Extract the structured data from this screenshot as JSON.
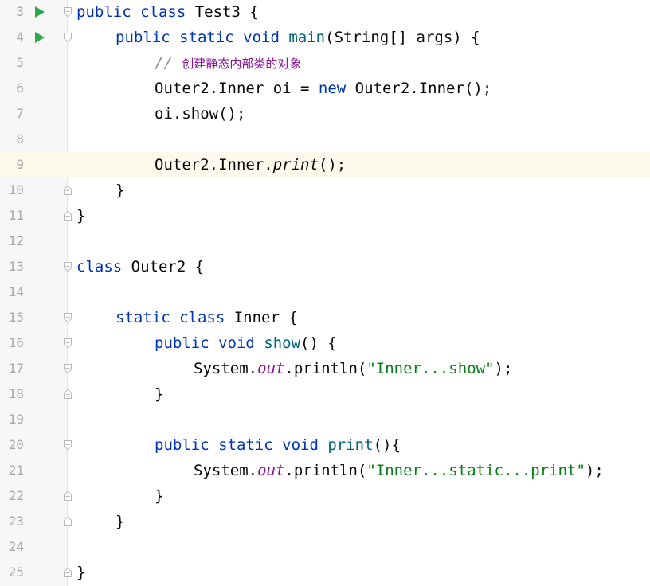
{
  "editor": {
    "current_line": 9,
    "lines": [
      {
        "n": "3",
        "indent": 0,
        "run": true,
        "fold": "open",
        "tokens": [
          {
            "t": "public ",
            "c": "kw"
          },
          {
            "t": "class ",
            "c": "kw"
          },
          {
            "t": "Test3 {",
            "c": ""
          }
        ]
      },
      {
        "n": "4",
        "indent": 1,
        "run": true,
        "fold": "open",
        "tokens": [
          {
            "t": "public ",
            "c": "kw"
          },
          {
            "t": "static ",
            "c": "kw"
          },
          {
            "t": "void ",
            "c": "kw"
          },
          {
            "t": "main",
            "c": "fn"
          },
          {
            "t": "(String[] args) {",
            "c": ""
          }
        ]
      },
      {
        "n": "5",
        "indent": 2,
        "tokens": [
          {
            "t": "// ",
            "c": "cmt"
          },
          {
            "t": "创建静态内部类的对象",
            "c": "cmt-cn"
          }
        ]
      },
      {
        "n": "6",
        "indent": 2,
        "tokens": [
          {
            "t": "Outer2.Inner oi = ",
            "c": ""
          },
          {
            "t": "new ",
            "c": "kw"
          },
          {
            "t": "Outer2.Inner();",
            "c": ""
          }
        ]
      },
      {
        "n": "7",
        "indent": 2,
        "tokens": [
          {
            "t": "oi.show();",
            "c": ""
          }
        ]
      },
      {
        "n": "8",
        "indent": 0,
        "tokens": []
      },
      {
        "n": "9",
        "indent": 2,
        "tokens": [
          {
            "t": "Outer2.Inner.",
            "c": ""
          },
          {
            "t": "print",
            "c": "ital"
          },
          {
            "t": "();",
            "c": ""
          }
        ]
      },
      {
        "n": "10",
        "indent": 1,
        "fold": "close",
        "tokens": [
          {
            "t": "}",
            "c": ""
          }
        ]
      },
      {
        "n": "11",
        "indent": 0,
        "fold": "close",
        "tokens": [
          {
            "t": "}",
            "c": ""
          }
        ]
      },
      {
        "n": "12",
        "indent": 0,
        "tokens": []
      },
      {
        "n": "13",
        "indent": 0,
        "fold": "open",
        "tokens": [
          {
            "t": "class ",
            "c": "kw"
          },
          {
            "t": "Outer2 {",
            "c": ""
          }
        ]
      },
      {
        "n": "14",
        "indent": 0,
        "tokens": []
      },
      {
        "n": "15",
        "indent": 1,
        "fold": "open",
        "tokens": [
          {
            "t": "static ",
            "c": "kw"
          },
          {
            "t": "class ",
            "c": "kw"
          },
          {
            "t": "Inner {",
            "c": ""
          }
        ]
      },
      {
        "n": "16",
        "indent": 2,
        "fold": "open",
        "tokens": [
          {
            "t": "public ",
            "c": "kw"
          },
          {
            "t": "void ",
            "c": "kw"
          },
          {
            "t": "show",
            "c": "fn"
          },
          {
            "t": "() {",
            "c": ""
          }
        ]
      },
      {
        "n": "17",
        "indent": 3,
        "fold": "open",
        "tokens": [
          {
            "t": "System.",
            "c": ""
          },
          {
            "t": "out",
            "c": "fld"
          },
          {
            "t": ".println(",
            "c": ""
          },
          {
            "t": "\"Inner...show\"",
            "c": "str"
          },
          {
            "t": ");",
            "c": ""
          }
        ]
      },
      {
        "n": "18",
        "indent": 2,
        "fold": "close",
        "tokens": [
          {
            "t": "}",
            "c": ""
          }
        ]
      },
      {
        "n": "19",
        "indent": 0,
        "tokens": []
      },
      {
        "n": "20",
        "indent": 2,
        "fold": "open",
        "tokens": [
          {
            "t": "public ",
            "c": "kw"
          },
          {
            "t": "static ",
            "c": "kw"
          },
          {
            "t": "void ",
            "c": "kw"
          },
          {
            "t": "print",
            "c": "fn"
          },
          {
            "t": "(){",
            "c": ""
          }
        ]
      },
      {
        "n": "21",
        "indent": 3,
        "tokens": [
          {
            "t": "System.",
            "c": ""
          },
          {
            "t": "out",
            "c": "fld"
          },
          {
            "t": ".println(",
            "c": ""
          },
          {
            "t": "\"Inner...static...print\"",
            "c": "str"
          },
          {
            "t": ");",
            "c": ""
          }
        ]
      },
      {
        "n": "22",
        "indent": 2,
        "fold": "close",
        "tokens": [
          {
            "t": "}",
            "c": ""
          }
        ]
      },
      {
        "n": "23",
        "indent": 1,
        "fold": "close",
        "tokens": [
          {
            "t": "}",
            "c": ""
          }
        ]
      },
      {
        "n": "24",
        "indent": 0,
        "tokens": []
      },
      {
        "n": "25",
        "indent": 0,
        "fold": "close",
        "tokens": [
          {
            "t": "}",
            "c": ""
          }
        ]
      }
    ]
  },
  "colors": {
    "keyword": "#0033b3",
    "method": "#00627a",
    "string": "#067d17",
    "static_field": "#871094",
    "comment": "#8c8c8c",
    "line_number": "#a8a8a8",
    "run_icon": "#2ba84a",
    "current_line_bg": "#fcfaed"
  },
  "icons": {
    "run": "run-gutter-icon",
    "fold_open": "fold-open-icon",
    "fold_close": "fold-close-icon"
  }
}
